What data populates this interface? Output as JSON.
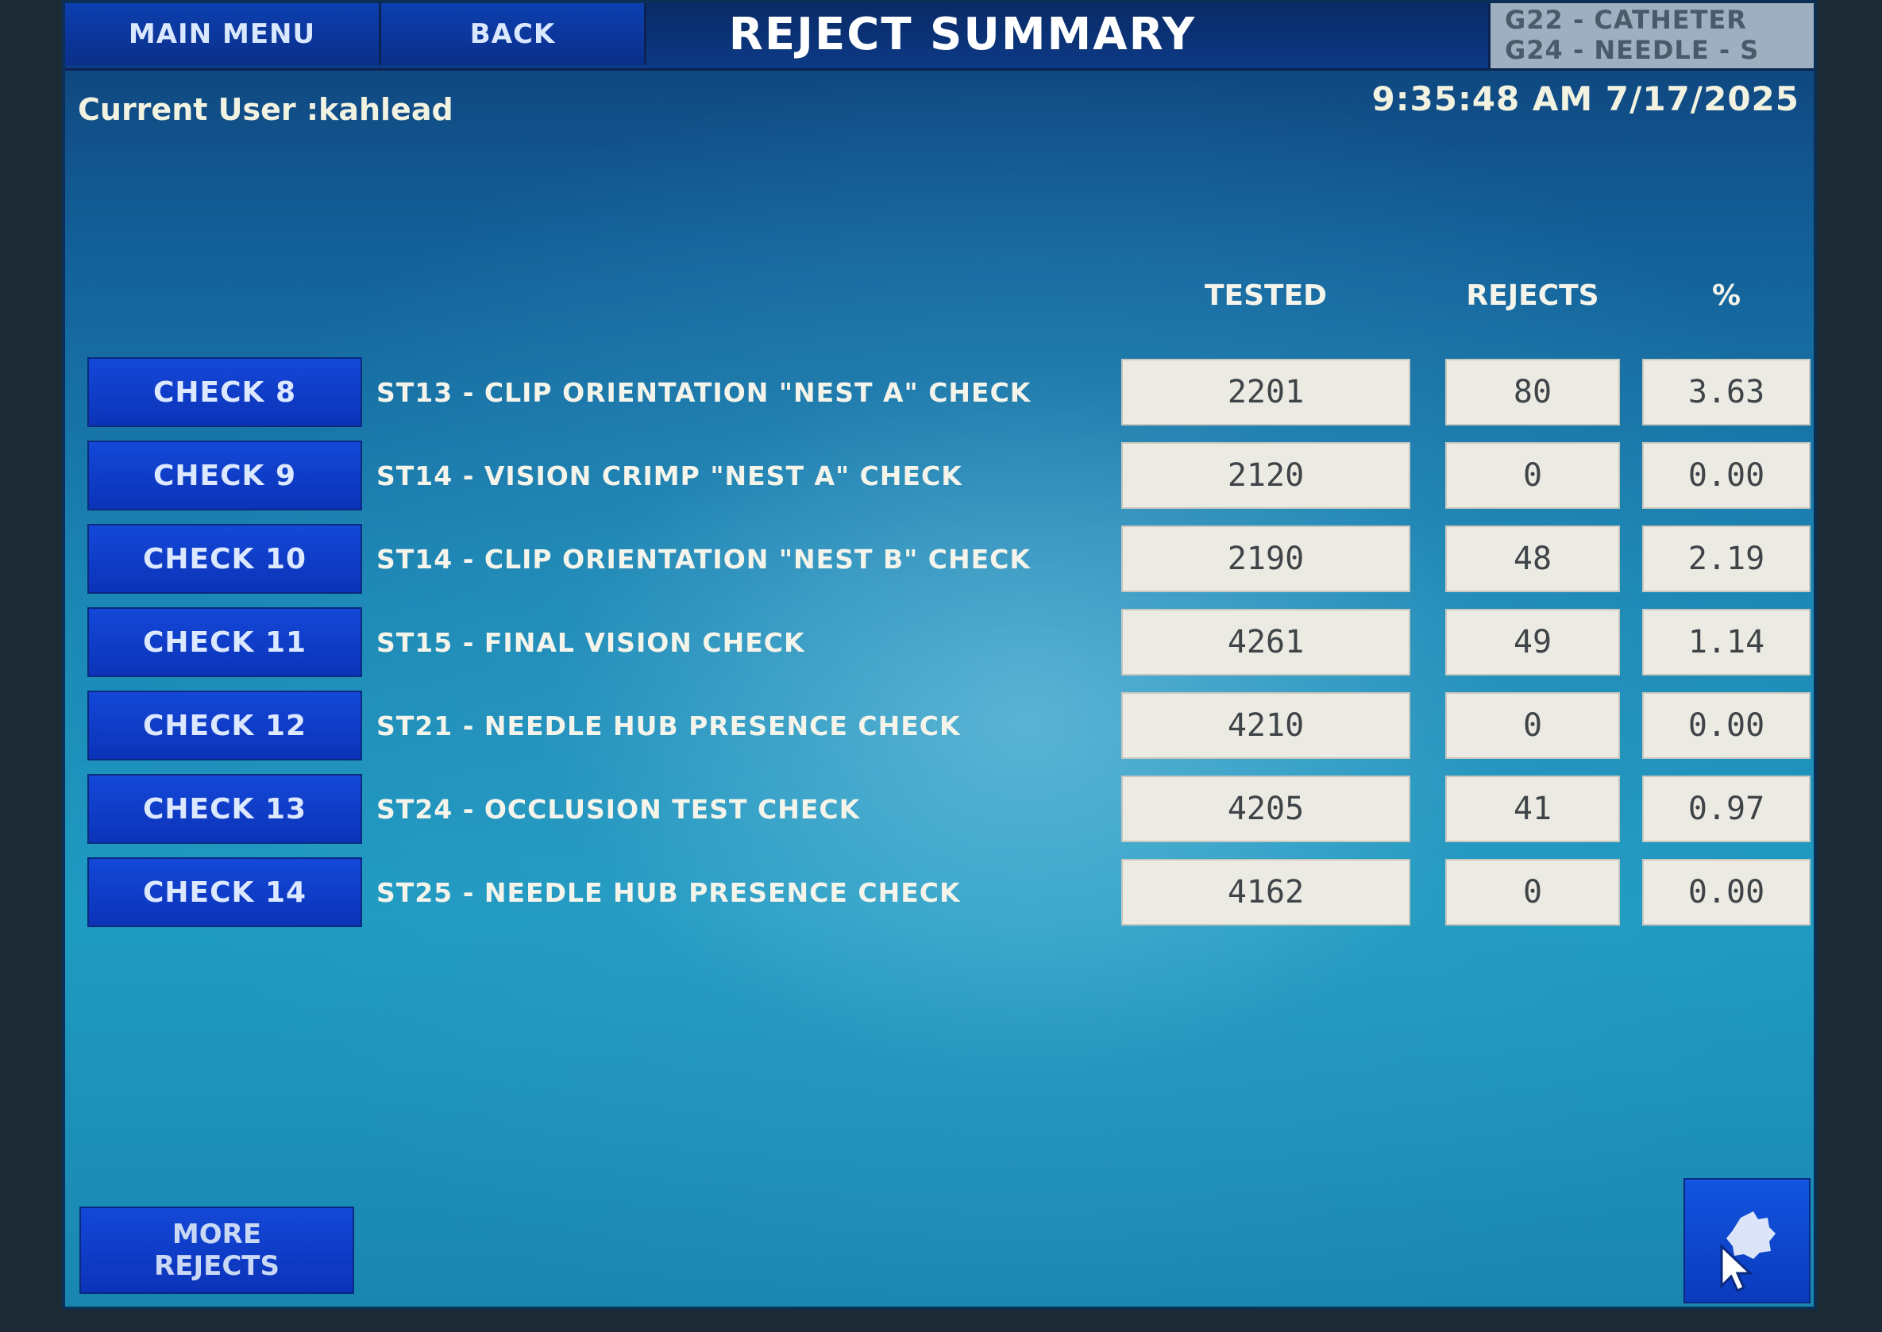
{
  "header": {
    "main_menu_label": "MAIN MENU",
    "back_label": "BACK",
    "title": "REJECT SUMMARY",
    "product_line1": "G22 - CATHETER",
    "product_line2": "G24 - NEEDLE - S"
  },
  "status": {
    "current_user": "Current User :kahlead",
    "datetime": "9:35:48 AM 7/17/2025"
  },
  "columns": {
    "tested": "TESTED",
    "rejects": "REJECTS",
    "percent": "%"
  },
  "rows": [
    {
      "check": "CHECK 8",
      "desc": "ST13 - CLIP ORIENTATION \"NEST A\" CHECK",
      "tested": "2201",
      "rejects": "80",
      "pct": "3.63"
    },
    {
      "check": "CHECK 9",
      "desc": "ST14 - VISION CRIMP \"NEST A\" CHECK",
      "tested": "2120",
      "rejects": "0",
      "pct": "0.00"
    },
    {
      "check": "CHECK 10",
      "desc": "ST14 - CLIP ORIENTATION \"NEST B\" CHECK",
      "tested": "2190",
      "rejects": "48",
      "pct": "2.19"
    },
    {
      "check": "CHECK 11",
      "desc": "ST15 - FINAL VISION CHECK",
      "tested": "4261",
      "rejects": "49",
      "pct": "1.14"
    },
    {
      "check": "CHECK 12",
      "desc": "ST21 - NEEDLE HUB PRESENCE CHECK",
      "tested": "4210",
      "rejects": "0",
      "pct": "0.00"
    },
    {
      "check": "CHECK 13",
      "desc": "ST24 - OCCLUSION TEST CHECK",
      "tested": "4205",
      "rejects": "41",
      "pct": "0.97"
    },
    {
      "check": "CHECK 14",
      "desc": "ST25 - NEEDLE HUB PRESENCE CHECK",
      "tested": "4162",
      "rejects": "0",
      "pct": "0.00"
    }
  ],
  "footer": {
    "more_line1": "MORE",
    "more_line2": "REJECTS",
    "nav_icon": "navigation-cursor-icon"
  },
  "colors": {
    "button_blue": "#0b33b8",
    "value_box": "#ecebe3",
    "header_bar": "#0a2a66"
  }
}
